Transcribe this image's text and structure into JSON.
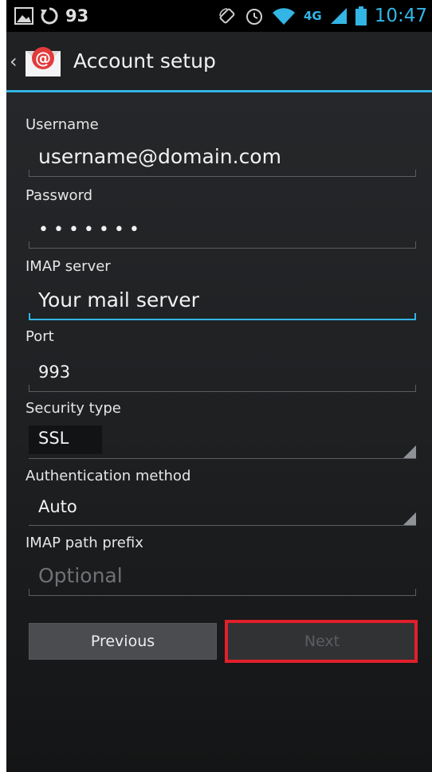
{
  "status_bar": {
    "notification_count": "93",
    "network_label": "4G",
    "time": "10:47",
    "icons": [
      "image-icon",
      "sync-icon",
      "rotate-icon",
      "alarm-icon",
      "wifi-icon",
      "signal-icon",
      "battery-icon"
    ]
  },
  "action_bar": {
    "title": "Account setup",
    "app_icon_text": "@",
    "accent_color": "#33b5e5"
  },
  "form": {
    "username": {
      "label": "Username",
      "value": "username@domain.com"
    },
    "password": {
      "label": "Password",
      "value": "•••••••"
    },
    "imap_server": {
      "label": "IMAP server",
      "value": "Your mail server"
    },
    "port": {
      "label": "Port",
      "value": "993"
    },
    "security_type": {
      "label": "Security type",
      "value": "SSL"
    },
    "auth_method": {
      "label": "Authentication method",
      "value": "Auto"
    },
    "imap_path_prefix": {
      "label": "IMAP path prefix",
      "placeholder": "Optional"
    }
  },
  "buttons": {
    "previous": "Previous",
    "next": "Next",
    "highlight_color": "#e0202a"
  }
}
